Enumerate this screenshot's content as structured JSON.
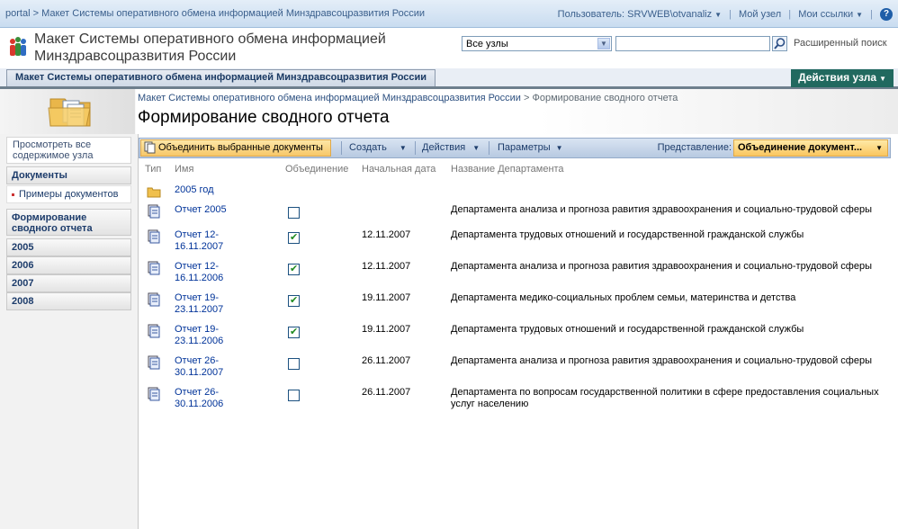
{
  "topbar": {
    "crumb_portal": "portal",
    "crumb_sep": ">",
    "crumb_site": "Макет Системы оперативного обмена информацией Минздравсоцразвития России",
    "user_label": "Пользователь: SRVWEB\\otvanaliz",
    "my_site": "Мой узел",
    "my_links": "Мои ссылки",
    "help": "?"
  },
  "header": {
    "site_title": "Макет Системы оперативного обмена информацией Минздравсоцразвития России",
    "scope_value": "Все узлы",
    "search_placeholder": "",
    "advanced_search": "Расширенный поиск"
  },
  "tabs": {
    "site_tab": "Макет Системы оперативного обмена информацией Минздравсоцразвития России",
    "site_actions": "Действия узла"
  },
  "page": {
    "breadcrumb_site": "Макет Системы оперативного обмена информацией Минздравсоцразвития России",
    "breadcrumb_sep": ">",
    "breadcrumb_current": "Формирование сводного отчета",
    "title": "Формирование сводного отчета"
  },
  "leftnav": {
    "view_all": "Просмотреть все содержимое узла",
    "documents": "Документы",
    "doc_examples": "Примеры документов",
    "report_form": "Формирование сводного отчета",
    "years": [
      "2005",
      "2006",
      "2007",
      "2008"
    ]
  },
  "toolbar": {
    "merge": "Объединить выбранные документы",
    "create": "Создать",
    "actions": "Действия",
    "settings": "Параметры",
    "view_label": "Представление:",
    "view_value": "Объединение документ..."
  },
  "list": {
    "headers": {
      "type": "Тип",
      "name": "Имя",
      "merge": "Объединение",
      "start_date": "Начальная дата",
      "department": "Название Департамента"
    },
    "rows": [
      {
        "kind": "folder",
        "name": "2005 год",
        "checked": null,
        "date": "",
        "dept": ""
      },
      {
        "kind": "doc",
        "name": "Отчет 2005",
        "checked": false,
        "date": "",
        "dept": "Департамента анализа и прогноза равития здравоохранения и социально-трудовой сферы"
      },
      {
        "kind": "doc",
        "name": "Отчет 12-16.11.2007",
        "checked": true,
        "date": "12.11.2007",
        "dept": "Департамента трудовых отношений и государственной гражданской службы"
      },
      {
        "kind": "doc",
        "name": "Отчет 12-16.11.2006",
        "checked": true,
        "date": "12.11.2007",
        "dept": "Департамента анализа и прогноза равития здравоохранения и социально-трудовой сферы"
      },
      {
        "kind": "doc",
        "name": "Отчет 19-23.11.2007",
        "checked": true,
        "date": "19.11.2007",
        "dept": "Департамента медико-социальных проблем семьи, материнства и детства"
      },
      {
        "kind": "doc",
        "name": "Отчет 19-23.11.2006",
        "checked": true,
        "date": "19.11.2007",
        "dept": "Департамента трудовых отношений и государственной гражданской службы"
      },
      {
        "kind": "doc",
        "name": "Отчет 26-30.11.2007",
        "checked": false,
        "date": "26.11.2007",
        "dept": "Департамента анализа и прогноза равития здравоохранения и социально-трудовой сферы"
      },
      {
        "kind": "doc",
        "name": "Отчет 26-30.11.2006",
        "checked": false,
        "date": "26.11.2007",
        "dept": "Департамента по вопросам государственной политики в сфере предоставления социальных услуг населению"
      }
    ]
  },
  "colors": {
    "site_actions_bg": "#21695f",
    "toolbar_bg": "#b7c9e1",
    "link": "#003399",
    "check_green": "#1f8a1f"
  }
}
